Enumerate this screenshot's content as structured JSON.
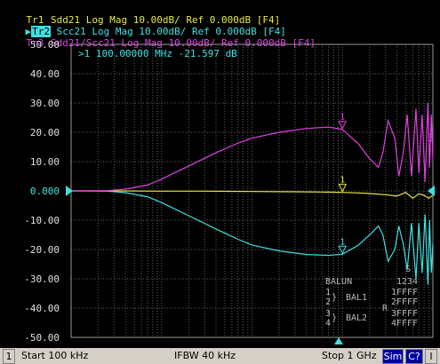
{
  "traces": [
    {
      "id": "Tr1",
      "text": " Sdd21 Log Mag 10.00dB/ Ref 0.000dB [F4]",
      "color": "#e8e840",
      "active": false
    },
    {
      "id": "Tr2",
      "text": " Scc21 Log Mag 10.00dB/ Ref 0.000dB [F4]",
      "color": "#40e0e0",
      "active": true
    },
    {
      "id": "Tr3",
      "text": " Sdd21/Scc21 Log Mag 10.00dB/ Ref 0.000dB [F4]",
      "color": "#e040e0",
      "active": false
    }
  ],
  "marker_readout": ">1  100.00000 MHz -21.597 dB",
  "marker_label": "1",
  "trace3_end_label": "3",
  "ref_value_label": "0.000",
  "balun": {
    "title": "BALUN",
    "port_cols": "1234",
    "s_label": "S",
    "r_label": "R",
    "rows": [
      "1FFFF",
      "2FFFF",
      "3FFFF",
      "4FFFF"
    ],
    "port_nums": [
      "1",
      "2",
      "3",
      "4"
    ],
    "bal1": "BAL1",
    "bal2": "BAL2"
  },
  "status": {
    "channel": "1",
    "start": "Start 100 kHz",
    "ifbw": "IFBW 40 kHz",
    "stop": "Stop 1 GHz",
    "sim": "Sim",
    "c2": "C?",
    "last": "I"
  },
  "colors": {
    "grid": "#606060",
    "frame": "#9a9a9a",
    "axis_text": "#e0e0e0",
    "tr1": "#e8e840",
    "tr2": "#40e0e0",
    "tr3": "#e040e0",
    "sim_bg": "#0000a0",
    "c2_bg": "#0000a0"
  },
  "chart_data": {
    "type": "line",
    "xscale": "log",
    "xlim": [
      100000,
      1000000000
    ],
    "ylim": [
      -50,
      50
    ],
    "yticks": [
      "50.00",
      "40.00",
      "30.00",
      "20.00",
      "10.00",
      "0.000",
      "-10.00",
      "-20.00",
      "-30.00",
      "-40.00",
      "-50.00"
    ],
    "grid": true,
    "series": [
      {
        "name": "Sdd21",
        "color": "#e8e840",
        "x": [
          100000,
          300000,
          1000000,
          3000000,
          10000000,
          30000000,
          60000000,
          100000000,
          150000000,
          200000000,
          300000000,
          400000000,
          500000000,
          600000000,
          700000000,
          800000000,
          900000000,
          1000000000
        ],
        "y": [
          0,
          0,
          -0.1,
          -0.1,
          -0.2,
          -0.3,
          -0.4,
          -0.5,
          -0.7,
          -0.9,
          -1.3,
          -1.8,
          -0.5,
          -2.5,
          -1.0,
          -1.5,
          -2.5,
          -1.5
        ]
      },
      {
        "name": "Scc21",
        "color": "#40e0e0",
        "x": [
          100000,
          250000,
          400000,
          700000,
          1000000,
          2000000,
          4000000,
          7000000,
          10000000,
          20000000,
          40000000,
          70000000,
          100000000,
          150000000,
          200000000,
          250000000,
          280000000,
          320000000,
          380000000,
          420000000,
          470000000,
          520000000,
          580000000,
          650000000,
          700000000,
          760000000,
          820000000,
          880000000,
          920000000,
          960000000,
          1000000000
        ],
        "y": [
          0,
          -0.1,
          -0.6,
          -2,
          -4,
          -8.5,
          -13,
          -16.5,
          -18.5,
          -20.5,
          -21.7,
          -22,
          -21.6,
          -18.5,
          -15,
          -12,
          -15,
          -24,
          -20,
          -12,
          -18,
          -27,
          -11,
          -30,
          -11,
          -28,
          -8,
          -32,
          -10,
          -28,
          -18
        ]
      },
      {
        "name": "Sdd21/Scc21",
        "color": "#e040e0",
        "x": [
          100000,
          250000,
          400000,
          700000,
          1000000,
          2000000,
          4000000,
          7000000,
          10000000,
          20000000,
          40000000,
          70000000,
          100000000,
          150000000,
          200000000,
          250000000,
          280000000,
          320000000,
          380000000,
          420000000,
          470000000,
          520000000,
          580000000,
          650000000,
          700000000,
          760000000,
          820000000,
          880000000,
          920000000,
          960000000,
          1000000000
        ],
        "y": [
          0,
          0.1,
          0.6,
          2,
          4,
          8.5,
          13,
          16.3,
          18,
          20,
          21.3,
          21.8,
          21,
          16,
          11,
          8,
          13,
          24,
          18,
          5,
          13,
          26,
          5,
          28,
          6,
          26,
          3,
          30,
          8,
          26,
          11
        ]
      }
    ],
    "marker": {
      "label": "1",
      "x": 100000000,
      "readout": "100.00000 MHz -21.597 dB"
    }
  }
}
